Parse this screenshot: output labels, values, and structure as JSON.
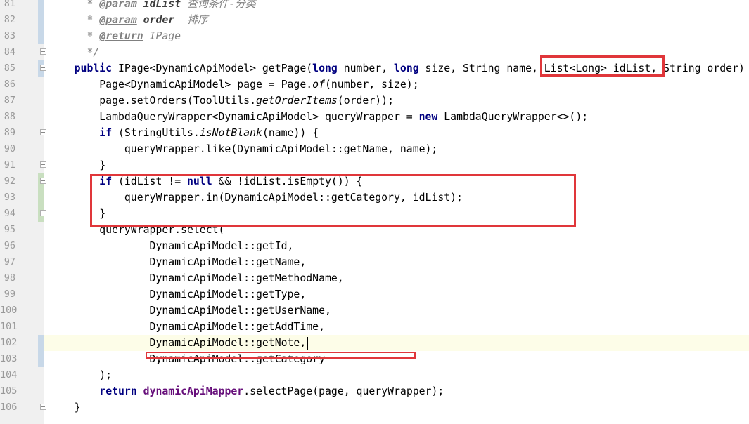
{
  "editor": {
    "lines": [
      {
        "num": "81",
        "tokens": [
          {
            "t": "      ",
            "c": ""
          },
          {
            "t": "* ",
            "c": "cm"
          },
          {
            "t": "@param",
            "c": "tag"
          },
          {
            "t": " ",
            "c": "cm"
          },
          {
            "t": "idList",
            "c": "pname"
          },
          {
            "t": " 查询条件-分类",
            "c": "cm"
          }
        ]
      },
      {
        "num": "82",
        "tokens": [
          {
            "t": "      ",
            "c": ""
          },
          {
            "t": "* ",
            "c": "cm"
          },
          {
            "t": "@param",
            "c": "tag"
          },
          {
            "t": " ",
            "c": "cm"
          },
          {
            "t": "order",
            "c": "pname"
          },
          {
            "t": "  排序",
            "c": "cm"
          }
        ]
      },
      {
        "num": "83",
        "tokens": [
          {
            "t": "      ",
            "c": ""
          },
          {
            "t": "* ",
            "c": "cm"
          },
          {
            "t": "@return",
            "c": "tag"
          },
          {
            "t": " IPage",
            "c": "cm"
          }
        ]
      },
      {
        "num": "84",
        "tokens": [
          {
            "t": "      ",
            "c": ""
          },
          {
            "t": "*/",
            "c": "cm"
          }
        ]
      },
      {
        "num": "85",
        "tokens": [
          {
            "t": "    ",
            "c": ""
          },
          {
            "t": "public",
            "c": "kw"
          },
          {
            "t": " IPage<DynamicApiModel> getPage(",
            "c": ""
          },
          {
            "t": "long",
            "c": "kw"
          },
          {
            "t": " number, ",
            "c": ""
          },
          {
            "t": "long",
            "c": "kw"
          },
          {
            "t": " size, String name, List<Long> idList, String order)",
            "c": ""
          }
        ]
      },
      {
        "num": "86",
        "tokens": [
          {
            "t": "        Page<DynamicApiModel> page = Page.",
            "c": ""
          },
          {
            "t": "of",
            "c": "it"
          },
          {
            "t": "(number, size);",
            "c": ""
          }
        ]
      },
      {
        "num": "87",
        "tokens": [
          {
            "t": "        page.setOrders(ToolUtils.",
            "c": ""
          },
          {
            "t": "getOrderItems",
            "c": "it"
          },
          {
            "t": "(order));",
            "c": ""
          }
        ]
      },
      {
        "num": "88",
        "tokens": [
          {
            "t": "        LambdaQueryWrapper<DynamicApiModel> queryWrapper = ",
            "c": ""
          },
          {
            "t": "new",
            "c": "kw"
          },
          {
            "t": " LambdaQueryWrapper<>();",
            "c": ""
          }
        ]
      },
      {
        "num": "89",
        "tokens": [
          {
            "t": "        ",
            "c": ""
          },
          {
            "t": "if",
            "c": "kw"
          },
          {
            "t": " (StringUtils.",
            "c": ""
          },
          {
            "t": "isNotBlank",
            "c": "it"
          },
          {
            "t": "(name)) {",
            "c": ""
          }
        ]
      },
      {
        "num": "90",
        "tokens": [
          {
            "t": "            queryWrapper.like(DynamicApiModel::getName, name);",
            "c": ""
          }
        ]
      },
      {
        "num": "91",
        "tokens": [
          {
            "t": "        }",
            "c": ""
          }
        ]
      },
      {
        "num": "92",
        "tokens": [
          {
            "t": "        ",
            "c": ""
          },
          {
            "t": "if",
            "c": "kw"
          },
          {
            "t": " (idList != ",
            "c": ""
          },
          {
            "t": "null",
            "c": "kw"
          },
          {
            "t": " && !idList.isEmpty()) {",
            "c": ""
          }
        ]
      },
      {
        "num": "93",
        "tokens": [
          {
            "t": "            queryWrapper.in(DynamicApiModel::getCategory, idList);",
            "c": ""
          }
        ]
      },
      {
        "num": "94",
        "tokens": [
          {
            "t": "        }",
            "c": ""
          }
        ]
      },
      {
        "num": "95",
        "tokens": [
          {
            "t": "        queryWrapper.select(",
            "c": ""
          }
        ]
      },
      {
        "num": "96",
        "tokens": [
          {
            "t": "                DynamicApiModel::getId,",
            "c": ""
          }
        ]
      },
      {
        "num": "97",
        "tokens": [
          {
            "t": "                DynamicApiModel::getName,",
            "c": ""
          }
        ]
      },
      {
        "num": "98",
        "tokens": [
          {
            "t": "                DynamicApiModel::getMethodName,",
            "c": ""
          }
        ]
      },
      {
        "num": "99",
        "tokens": [
          {
            "t": "                DynamicApiModel::getType,",
            "c": ""
          }
        ]
      },
      {
        "num": "100",
        "tokens": [
          {
            "t": "                DynamicApiModel::getUserName,",
            "c": ""
          }
        ]
      },
      {
        "num": "101",
        "tokens": [
          {
            "t": "                DynamicApiModel::getAddTime,",
            "c": ""
          }
        ]
      },
      {
        "num": "102",
        "tokens": [
          {
            "t": "                DynamicApiModel::getNote,",
            "c": ""
          }
        ]
      },
      {
        "num": "103",
        "tokens": [
          {
            "t": "                DynamicApiModel::getCategory",
            "c": ""
          }
        ]
      },
      {
        "num": "104",
        "tokens": [
          {
            "t": "        );",
            "c": ""
          }
        ]
      },
      {
        "num": "105",
        "tokens": [
          {
            "t": "        ",
            "c": ""
          },
          {
            "t": "return",
            "c": "kw"
          },
          {
            "t": " ",
            "c": ""
          },
          {
            "t": "dynamicApiMapper",
            "c": "fld"
          },
          {
            "t": ".selectPage(page, queryWrapper);",
            "c": ""
          }
        ]
      },
      {
        "num": "106",
        "tokens": [
          {
            "t": "    }",
            "c": ""
          }
        ]
      }
    ],
    "current_line": "102",
    "colors": {
      "keyword": "#000080",
      "field": "#660e7a",
      "comment": "#808080",
      "highlight_box": "#e0363a",
      "current_line_bg": "#fdfde8"
    }
  }
}
